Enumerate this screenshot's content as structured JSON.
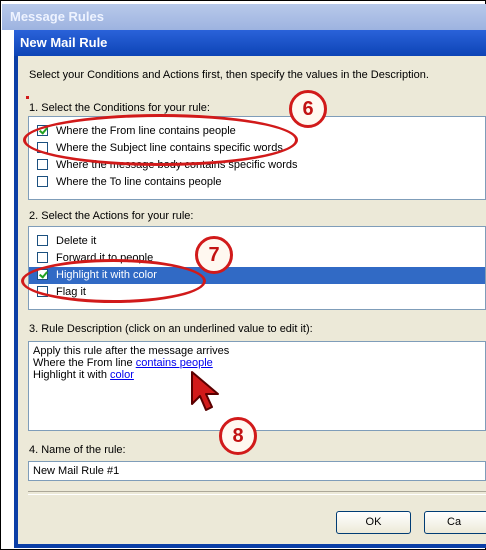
{
  "outer_window": {
    "title": "Message Rules"
  },
  "dialog": {
    "title": "New Mail Rule",
    "instruction": "Select your Conditions and Actions first, then specify the values in the Description."
  },
  "conditions": {
    "label": "1. Select the Conditions for your rule:",
    "items": [
      {
        "label": "Where the From line contains people",
        "checked": true
      },
      {
        "label": "Where the Subject line contains specific words",
        "checked": false
      },
      {
        "label": "Where the message body contains specific words",
        "checked": false
      },
      {
        "label": "Where the To line contains people",
        "checked": false
      }
    ]
  },
  "actions": {
    "label": "2. Select the Actions for your rule:",
    "items": [
      {
        "label": "Delete it",
        "checked": false
      },
      {
        "label": "Forward it to people",
        "checked": false
      },
      {
        "label": "Highlight it with color",
        "checked": true,
        "selected": true
      },
      {
        "label": "Flag it",
        "checked": false
      }
    ]
  },
  "description": {
    "label": "3. Rule Description (click on an underlined value to edit it):",
    "line1": "Apply this rule after the message arrives",
    "line2_prefix": "Where the From line ",
    "line2_link": "contains people",
    "line3_prefix": "Highlight it with ",
    "line3_link": "color"
  },
  "name": {
    "label": "4. Name of the rule:",
    "value": "New Mail Rule #1"
  },
  "buttons": {
    "ok": "OK",
    "cancel": "Ca"
  },
  "annotations": {
    "step6": "6",
    "step7": "7",
    "step8": "8",
    "color": "#d11a1a"
  }
}
